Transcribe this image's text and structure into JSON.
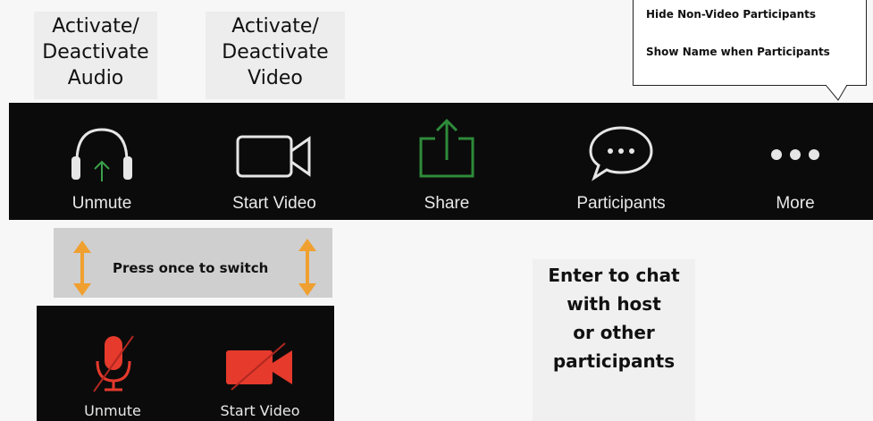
{
  "captions": {
    "audio": [
      "Activate/",
      "Deactivate",
      "Audio"
    ],
    "video": [
      "Activate/",
      "Deactivate",
      "Video"
    ]
  },
  "callout": {
    "line1": "Hide Non-Video Participants",
    "line2": "Show Name when Participants"
  },
  "toolbar": {
    "items": [
      {
        "label": "Unmute",
        "icon": "headphones-icon"
      },
      {
        "label": "Start Video",
        "icon": "video-camera-icon"
      },
      {
        "label": "Share",
        "icon": "share-icon"
      },
      {
        "label": "Participants",
        "icon": "chat-bubble-icon"
      },
      {
        "label": "More",
        "icon": "more-dots-icon"
      }
    ]
  },
  "switch_hint": "Press once to switch",
  "muted_panel": {
    "items": [
      {
        "label": "Unmute",
        "icon": "muted-microphone-icon"
      },
      {
        "label": "Start Video",
        "icon": "video-off-icon"
      }
    ]
  },
  "chat_note": [
    "Enter to chat",
    "with host",
    "or other",
    "participants"
  ],
  "colors": {
    "toolbar_bg": "#0b0b0b",
    "share_green": "#2e8b3a",
    "muted_red": "#e53a2c",
    "arrow_orange": "#f0a030"
  }
}
